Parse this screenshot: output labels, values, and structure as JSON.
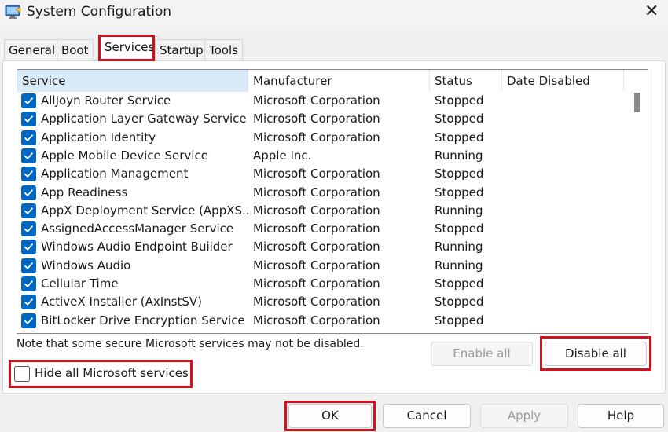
{
  "window": {
    "title": "System Configuration",
    "close_glyph": "✕"
  },
  "tabs": [
    "General",
    "Boot",
    "Services",
    "Startup",
    "Tools"
  ],
  "active_tab": "Services",
  "columns": [
    "Service",
    "Manufacturer",
    "Status",
    "Date Disabled"
  ],
  "services": [
    {
      "name": "AllJoyn Router Service",
      "manufacturer": "Microsoft Corporation",
      "status": "Stopped",
      "date_disabled": "",
      "checked": true
    },
    {
      "name": "Application Layer Gateway Service",
      "manufacturer": "Microsoft Corporation",
      "status": "Stopped",
      "date_disabled": "",
      "checked": true
    },
    {
      "name": "Application Identity",
      "manufacturer": "Microsoft Corporation",
      "status": "Stopped",
      "date_disabled": "",
      "checked": true
    },
    {
      "name": "Apple Mobile Device Service",
      "manufacturer": "Apple Inc.",
      "status": "Running",
      "date_disabled": "",
      "checked": true
    },
    {
      "name": "Application Management",
      "manufacturer": "Microsoft Corporation",
      "status": "Stopped",
      "date_disabled": "",
      "checked": true
    },
    {
      "name": "App Readiness",
      "manufacturer": "Microsoft Corporation",
      "status": "Stopped",
      "date_disabled": "",
      "checked": true
    },
    {
      "name": "AppX Deployment Service (AppXS...",
      "manufacturer": "Microsoft Corporation",
      "status": "Running",
      "date_disabled": "",
      "checked": true
    },
    {
      "name": "AssignedAccessManager Service",
      "manufacturer": "Microsoft Corporation",
      "status": "Stopped",
      "date_disabled": "",
      "checked": true
    },
    {
      "name": "Windows Audio Endpoint Builder",
      "manufacturer": "Microsoft Corporation",
      "status": "Running",
      "date_disabled": "",
      "checked": true
    },
    {
      "name": "Windows Audio",
      "manufacturer": "Microsoft Corporation",
      "status": "Running",
      "date_disabled": "",
      "checked": true
    },
    {
      "name": "Cellular Time",
      "manufacturer": "Microsoft Corporation",
      "status": "Stopped",
      "date_disabled": "",
      "checked": true
    },
    {
      "name": "ActiveX Installer (AxInstSV)",
      "manufacturer": "Microsoft Corporation",
      "status": "Stopped",
      "date_disabled": "",
      "checked": true
    },
    {
      "name": "BitLocker Drive Encryption Service",
      "manufacturer": "Microsoft Corporation",
      "status": "Stopped",
      "date_disabled": "",
      "checked": true
    }
  ],
  "note": "Note that some secure Microsoft services may not be disabled.",
  "buttons": {
    "enable_all": "Enable all",
    "disable_all": "Disable all",
    "ok": "OK",
    "cancel": "Cancel",
    "apply": "Apply",
    "help": "Help"
  },
  "hide_ms": {
    "label": "Hide all Microsoft services",
    "checked": false
  },
  "colors": {
    "accent": "#0067c0",
    "highlight": "#d0121f",
    "header_selected": "#d9ebf9"
  },
  "icons": {
    "app": "system-configuration-icon",
    "close": "close-icon",
    "check": "checkmark-icon"
  }
}
